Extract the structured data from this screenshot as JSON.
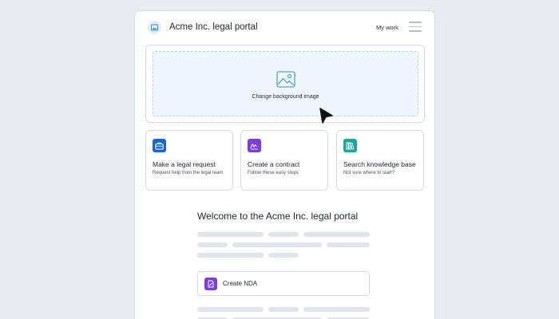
{
  "header": {
    "title": "Acme Inc. legal portal",
    "my_work_label": "My work",
    "logo_icon": "image-icon",
    "menu_icon": "hamburger-menu-icon"
  },
  "background_panel": {
    "label": "Change background image",
    "icon": "image-icon"
  },
  "actions": [
    {
      "title": "Make a legal request",
      "subtitle": "Request help from the legal team",
      "icon": "briefcase-icon",
      "color": "#1565d8"
    },
    {
      "title": "Create a contract",
      "subtitle": "Follow these easy steps",
      "icon": "signature-icon",
      "color": "#7c3fd6"
    },
    {
      "title": "Search knowledge base",
      "subtitle": "Not sure where to start?",
      "icon": "books-icon",
      "color": "#1aa89a"
    }
  ],
  "welcome": "Welcome to the Acme Inc. legal portal",
  "nda": {
    "label": "Create NDA",
    "icon": "document-edit-icon",
    "color": "#7c3fd6"
  },
  "colors": {
    "page_background": "#e8ebf0",
    "drop_zone": "#eef7fb",
    "skeleton": "#e1e4e9"
  }
}
